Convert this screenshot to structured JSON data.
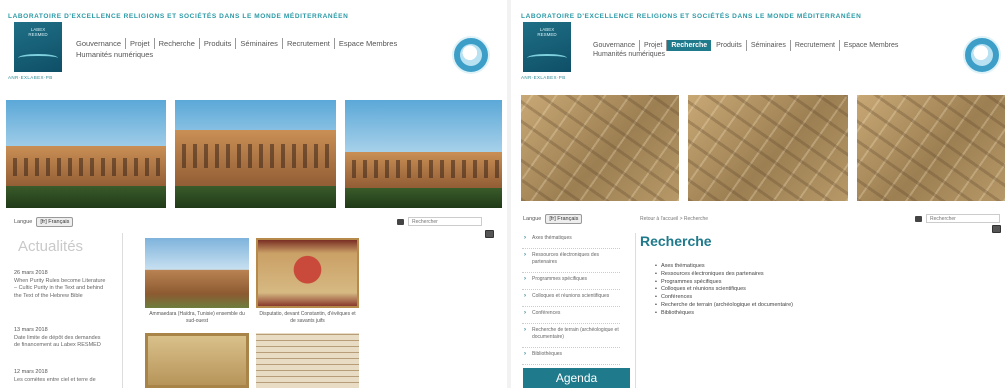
{
  "site_title": "Laboratoire d'excellence   Religions et sociétés dans le monde méditerranéen",
  "logo_sublabel": "ANR·EXLABEX·PB",
  "nav": [
    {
      "label": "Gouvernance"
    },
    {
      "label": "Projet"
    },
    {
      "label": "Recherche"
    },
    {
      "label": "Produits"
    },
    {
      "label": "Séminaires"
    },
    {
      "label": "Recrutement"
    },
    {
      "label": "Espace Membres"
    }
  ],
  "nav_second": "Humanités numériques",
  "active_nav_right": "Recherche",
  "language": {
    "label": "Langue",
    "selected": "[fr] Français"
  },
  "search": {
    "placeholder": "Rechercher"
  },
  "left": {
    "actualites_title": "Actualités",
    "news": [
      {
        "date": "26 mars 2018",
        "text": "When Purity Rules become Literature – Cultic Purity in the Text and behind the Text of the Hebrew Bible"
      },
      {
        "date": "13 mars 2018",
        "text": "Date limite de dépôt des demandes de financement au Labex RESMED"
      },
      {
        "date": "12 mars 2018",
        "text": "Les comètes entre ciel et terre de"
      }
    ],
    "gallery": [
      {
        "caption": "Ammaedara (Haïdra, Tunisie) ensemble du sud-ouest"
      },
      {
        "caption": "Disputatio, devant Constantin, d'évêques et de savants juifs"
      },
      {
        "caption": ""
      },
      {
        "caption": ""
      }
    ]
  },
  "right": {
    "breadcrumb": "Retour à l'accueil > Recherche",
    "heading": "Recherche",
    "menu": [
      "Axes thématiques",
      "Ressources électroniques des partenaires",
      "Programmes spécifiques",
      "Colloques et réunions scientifiques",
      "Conférences",
      "Recherche de terrain (archéologique et documentaire)",
      "Bibliothèques"
    ],
    "list": [
      "Axes thématiques",
      "Ressources électroniques des partenaires",
      "Programmes spécifiques",
      "Colloques et réunions scientifiques",
      "Conférences",
      "Recherche de terrain (archéologique et documentaire)",
      "Bibliothèques"
    ],
    "agenda_label": "Agenda"
  },
  "colors": {
    "accent": "#1f7a8c",
    "title_teal": "#2a9aa6",
    "seal_blue": "#3d9fc8"
  }
}
